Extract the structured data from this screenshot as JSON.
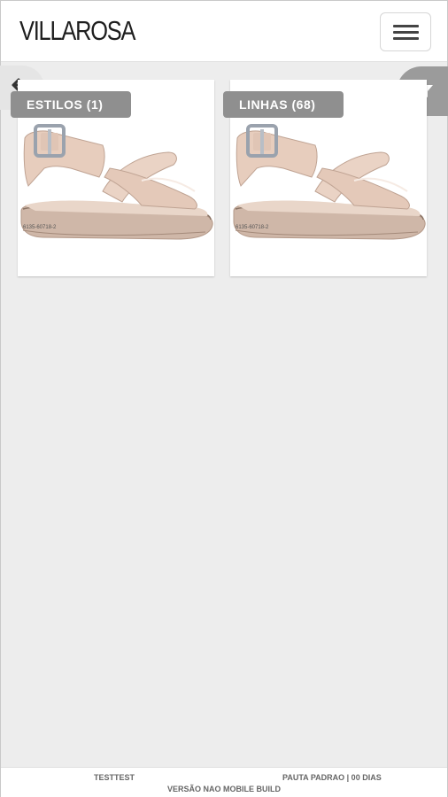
{
  "header": {
    "brand": "VILLAROSA",
    "menu_icon": "hamburger-icon"
  },
  "nav": {
    "back_icon": "back-arrow-icon",
    "filter_icon": "filter-icon"
  },
  "cards": [
    {
      "tag": "ESTILOS (1)",
      "code": "6135-60718-2",
      "image": "beige-platform-sandal"
    },
    {
      "tag": "LINHAS (68)",
      "code": "6135-60718-2",
      "image": "beige-platform-sandal"
    }
  ],
  "footer": {
    "left": "TESTTEST",
    "right": "PAUTA PADRAO | 00 DIAS",
    "center": "VERSÃO NAO MOBILE BUILD"
  },
  "colors": {
    "background": "#ededed",
    "tag": "#8f8f8f",
    "filter_button": "#9b9b9b",
    "sandal": "#e7cdbd"
  }
}
